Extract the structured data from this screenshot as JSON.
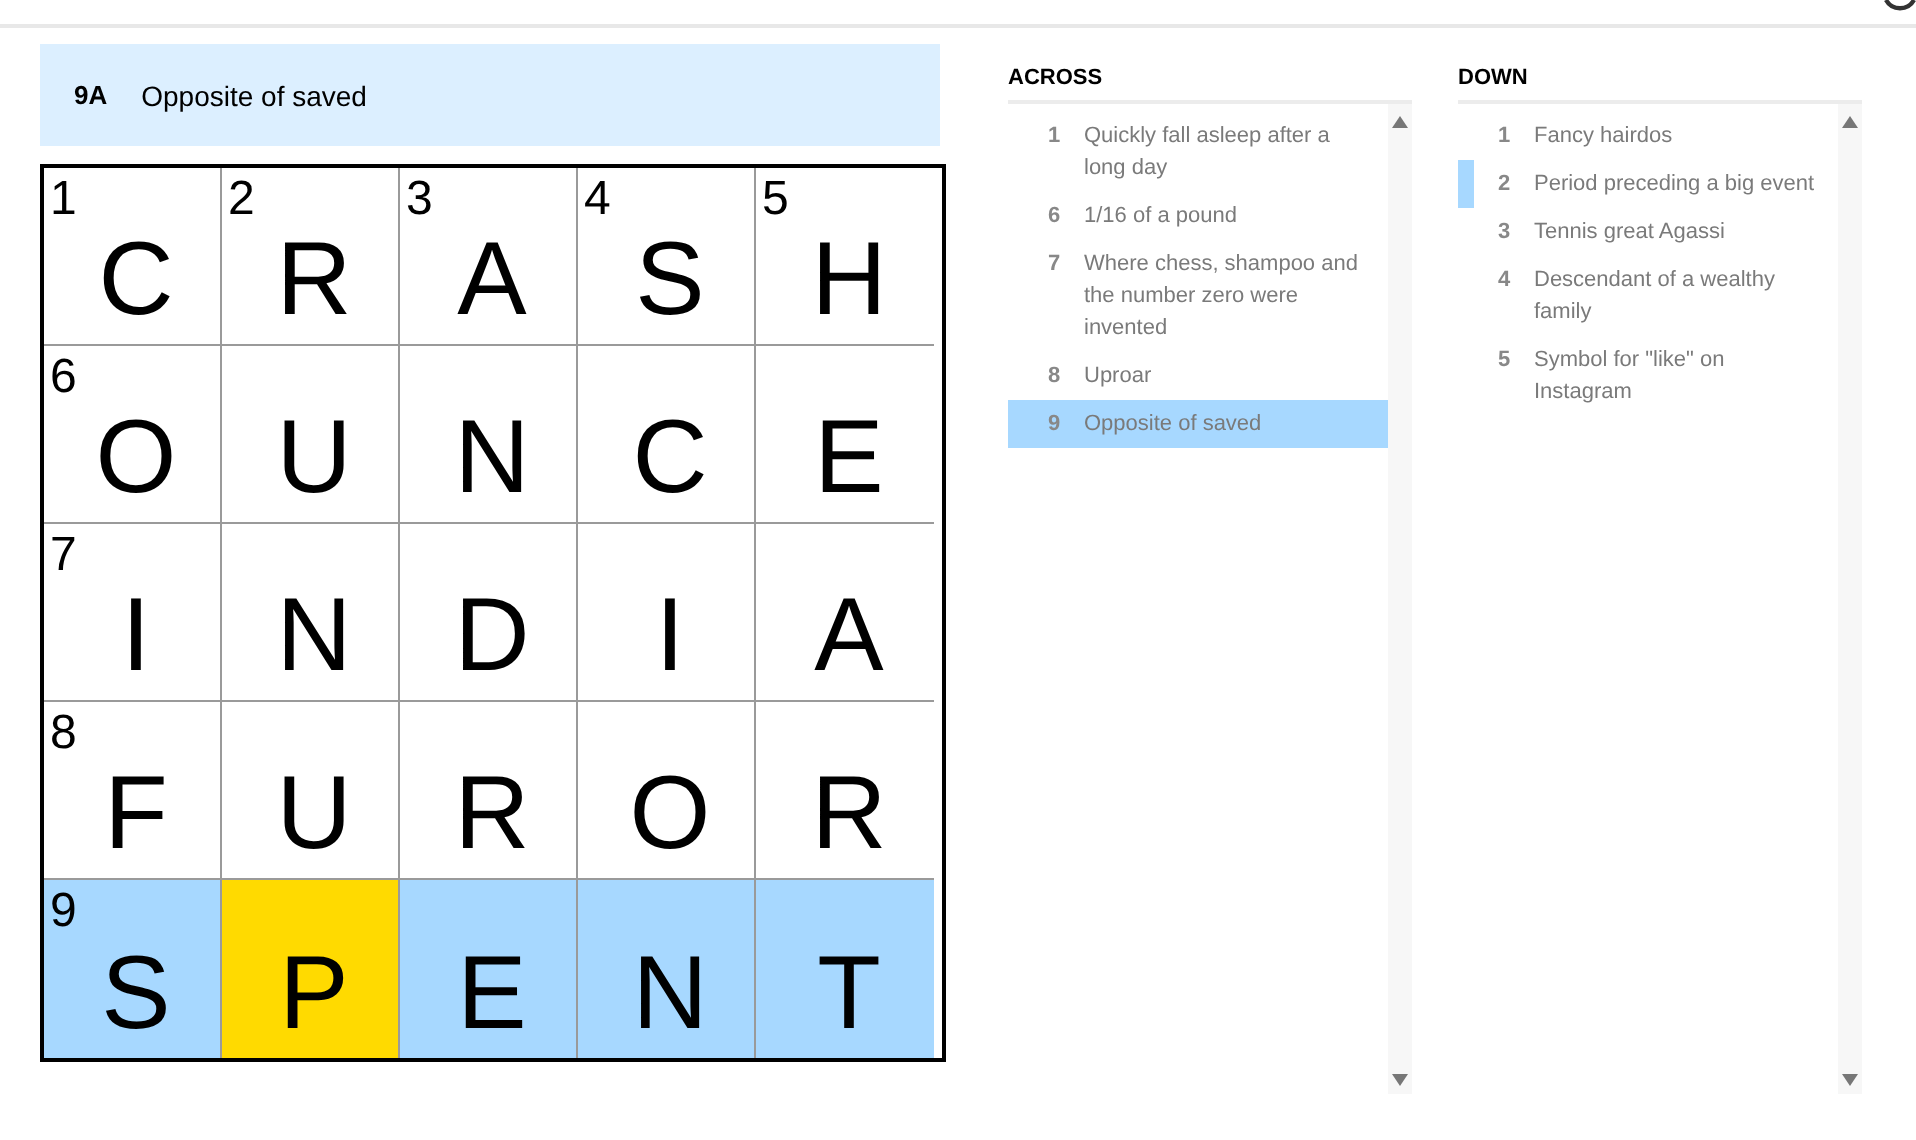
{
  "active_clue": {
    "label": "9A",
    "text": "Opposite of saved"
  },
  "grid": [
    [
      {
        "number": "1",
        "letter": "C",
        "highlighted": false,
        "selected": false
      },
      {
        "number": "2",
        "letter": "R",
        "highlighted": false,
        "selected": false
      },
      {
        "number": "3",
        "letter": "A",
        "highlighted": false,
        "selected": false
      },
      {
        "number": "4",
        "letter": "S",
        "highlighted": false,
        "selected": false
      },
      {
        "number": "5",
        "letter": "H",
        "highlighted": false,
        "selected": false
      }
    ],
    [
      {
        "number": "6",
        "letter": "O",
        "highlighted": false,
        "selected": false
      },
      {
        "letter": "U",
        "highlighted": false,
        "selected": false
      },
      {
        "letter": "N",
        "highlighted": false,
        "selected": false
      },
      {
        "letter": "C",
        "highlighted": false,
        "selected": false
      },
      {
        "letter": "E",
        "highlighted": false,
        "selected": false
      }
    ],
    [
      {
        "number": "7",
        "letter": "I",
        "highlighted": false,
        "selected": false
      },
      {
        "letter": "N",
        "highlighted": false,
        "selected": false
      },
      {
        "letter": "D",
        "highlighted": false,
        "selected": false
      },
      {
        "letter": "I",
        "highlighted": false,
        "selected": false
      },
      {
        "letter": "A",
        "highlighted": false,
        "selected": false
      }
    ],
    [
      {
        "number": "8",
        "letter": "F",
        "highlighted": false,
        "selected": false
      },
      {
        "letter": "U",
        "highlighted": false,
        "selected": false
      },
      {
        "letter": "R",
        "highlighted": false,
        "selected": false
      },
      {
        "letter": "O",
        "highlighted": false,
        "selected": false
      },
      {
        "letter": "R",
        "highlighted": false,
        "selected": false
      }
    ],
    [
      {
        "number": "9",
        "letter": "S",
        "highlighted": true,
        "selected": false
      },
      {
        "letter": "P",
        "highlighted": true,
        "selected": true
      },
      {
        "letter": "E",
        "highlighted": true,
        "selected": false
      },
      {
        "letter": "N",
        "highlighted": true,
        "selected": false
      },
      {
        "letter": "T",
        "highlighted": true,
        "selected": false
      }
    ]
  ],
  "clue_lists": [
    {
      "title": "ACROSS",
      "clues": [
        {
          "number": "1",
          "text": "Quickly fall asleep after a long day",
          "selected": false,
          "crossing": false
        },
        {
          "number": "6",
          "text": "1/16 of a pound",
          "selected": false,
          "crossing": false
        },
        {
          "number": "7",
          "text": "Where chess, shampoo and the number zero were invented",
          "selected": false,
          "crossing": false
        },
        {
          "number": "8",
          "text": "Uproar",
          "selected": false,
          "crossing": false
        },
        {
          "number": "9",
          "text": "Opposite of saved",
          "selected": true,
          "crossing": false
        }
      ]
    },
    {
      "title": "DOWN",
      "clues": [
        {
          "number": "1",
          "text": "Fancy hairdos",
          "selected": false,
          "crossing": false
        },
        {
          "number": "2",
          "text": "Period preceding a big event",
          "selected": false,
          "crossing": true
        },
        {
          "number": "3",
          "text": "Tennis great Agassi",
          "selected": false,
          "crossing": false
        },
        {
          "number": "4",
          "text": "Descendant of a wealthy family",
          "selected": false,
          "crossing": false
        },
        {
          "number": "5",
          "text": "Symbol for \"like\" on Instagram",
          "selected": false,
          "crossing": false
        }
      ]
    }
  ]
}
